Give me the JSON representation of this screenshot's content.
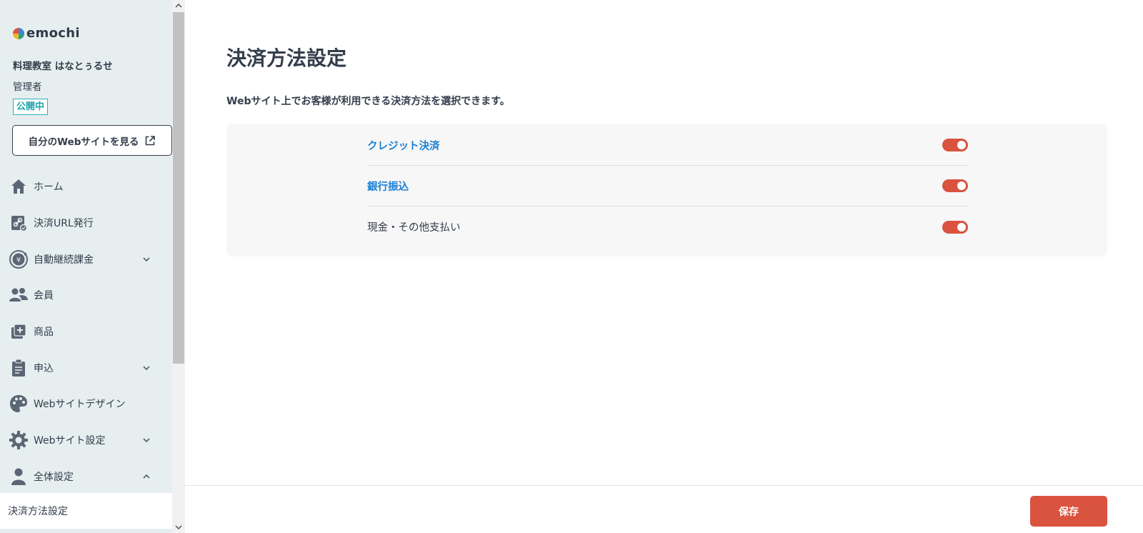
{
  "app": {
    "logo_text": "emochi"
  },
  "sidebar": {
    "org_name": "料理教室 はなとぅるせ",
    "role": "管理者",
    "status_badge": "公開中",
    "site_button_label": "自分のWebサイトを見る",
    "items": [
      {
        "label": "ホーム",
        "icon": "home-icon",
        "expandable": false
      },
      {
        "label": "決済URL発行",
        "icon": "payment-link-icon",
        "expandable": false
      },
      {
        "label": "自動継続課金",
        "icon": "recurring-yen-icon",
        "expandable": true,
        "expanded": false
      },
      {
        "label": "会員",
        "icon": "members-icon",
        "expandable": false
      },
      {
        "label": "商品",
        "icon": "product-add-icon",
        "expandable": false
      },
      {
        "label": "申込",
        "icon": "clipboard-icon",
        "expandable": true,
        "expanded": false
      },
      {
        "label": "Webサイトデザイン",
        "icon": "palette-icon",
        "expandable": false
      },
      {
        "label": "Webサイト設定",
        "icon": "gear-icon",
        "expandable": true,
        "expanded": false
      },
      {
        "label": "全体設定",
        "icon": "person-icon",
        "expandable": true,
        "expanded": true
      }
    ],
    "active_sub_item": "決済方法設定"
  },
  "main": {
    "title": "決済方法設定",
    "description": "Webサイト上でお客様が利用できる決済方法を選択できます。",
    "methods": [
      {
        "label": "クレジット決済",
        "linked": true,
        "enabled": true
      },
      {
        "label": "銀行振込",
        "linked": true,
        "enabled": true
      },
      {
        "label": "現金・その他支払い",
        "linked": false,
        "enabled": true
      }
    ],
    "save_label": "保存"
  },
  "colors": {
    "sidebar_bg": "#e7eef0",
    "accent_red": "#d9533f",
    "link_blue": "#1a7fd4",
    "badge_teal": "#1aa3a8"
  }
}
